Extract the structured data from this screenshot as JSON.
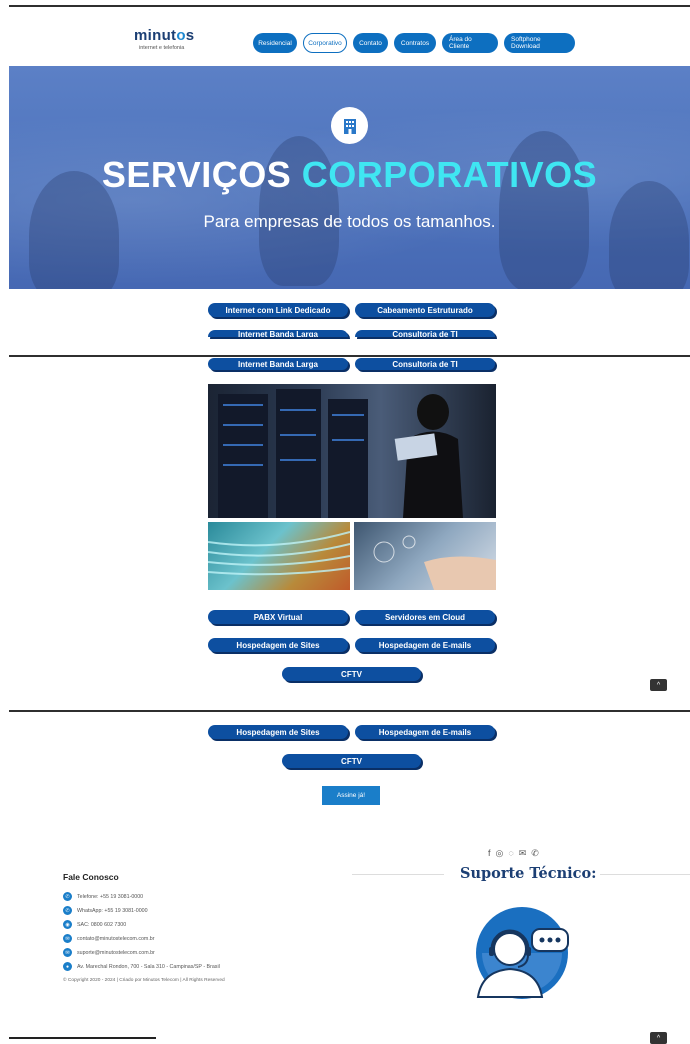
{
  "brand": {
    "name_prefix": "minut",
    "name_accent": "o",
    "name_suffix": "s",
    "tagline": "internet e telefonia"
  },
  "nav": [
    {
      "label": "Residencial",
      "active": false
    },
    {
      "label": "Corporativo",
      "active": true
    },
    {
      "label": "Contato",
      "active": false
    },
    {
      "label": "Contratos",
      "active": false
    },
    {
      "label": "Área do Cliente",
      "active": false
    },
    {
      "label": "Softphone Download",
      "active": false
    }
  ],
  "hero": {
    "icon": "office-building-icon",
    "title_white": "SERVIÇOS",
    "title_accent": "CORPORATIVOS",
    "subtitle": "Para empresas de todos os tamanhos.",
    "accent_color": "#3fe6f2"
  },
  "services": {
    "link_dedicado": "Internet com Link Dedicado",
    "cabeamento": "Cabeamento Estruturado",
    "banda_larga": "Internet Banda Larga",
    "consultoria": "Consultoria de TI",
    "pabx": "PABX Virtual",
    "servidores": "Servidores em Cloud",
    "hospedagem_sites": "Hospedagem de Sites",
    "hospedagem_emails": "Hospedagem de E-mails",
    "cftv": "CFTV"
  },
  "cta": {
    "label": "Assine já!"
  },
  "scroll_top": {
    "icon": "chevron-up-icon",
    "glyph": "^"
  },
  "footer": {
    "title": "Fale Conosco",
    "contacts": [
      {
        "icon": "phone-icon",
        "text": "Telefone: +55 19 3081-0000"
      },
      {
        "icon": "whatsapp-icon",
        "text": "WhatsApp: +55 19 3081-0000"
      },
      {
        "icon": "headset-icon",
        "text": "SAC: 0800 602 7300"
      },
      {
        "icon": "mail-icon",
        "text": "contato@minutostelecom.com.br"
      },
      {
        "icon": "mail-icon",
        "text": "suporte@minutostelecom.com.br"
      },
      {
        "icon": "location-icon",
        "text": "Av. Marechal Rondon, 700 - Sala 310 - Campinas/SP - Brasil"
      }
    ],
    "copyright": "© Copyright 2020 - 2024 | Criado por Minutos Telecom | All Rights Reserved",
    "support_title": "Suporte Técnico:",
    "social_icons": [
      "facebook-icon",
      "instagram-icon",
      "whatsapp-icon",
      "mail-icon",
      "phone-icon"
    ],
    "social_glyphs": [
      "f",
      "◎",
      "◌",
      "✉",
      "✆"
    ]
  },
  "colors": {
    "primary": "#0d6fc0",
    "pill": "#0d4fa0",
    "navy": "#1c3f74",
    "hero_blue": "#4d73bc"
  }
}
